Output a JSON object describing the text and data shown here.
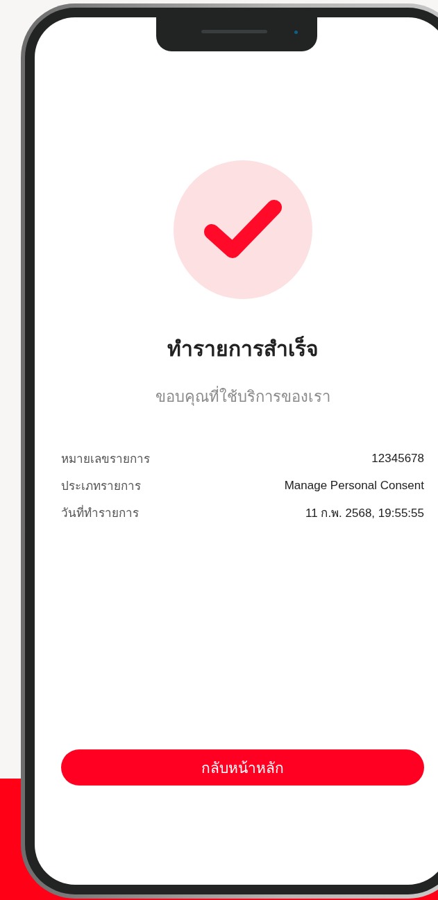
{
  "status": {
    "title": "ทำรายการสำเร็จ",
    "subtitle": "ขอบคุณที่ใช้บริการของเรา"
  },
  "details": [
    {
      "label": "หมายเลขรายการ",
      "value": "12345678"
    },
    {
      "label": "ประเภทรายการ",
      "value": "Manage Personal Consent"
    },
    {
      "label": "วันที่ทำรายการ",
      "value": "11 ก.พ. 2568, 19:55:55"
    }
  ],
  "button": {
    "label": "กลับหน้าหลัก"
  }
}
